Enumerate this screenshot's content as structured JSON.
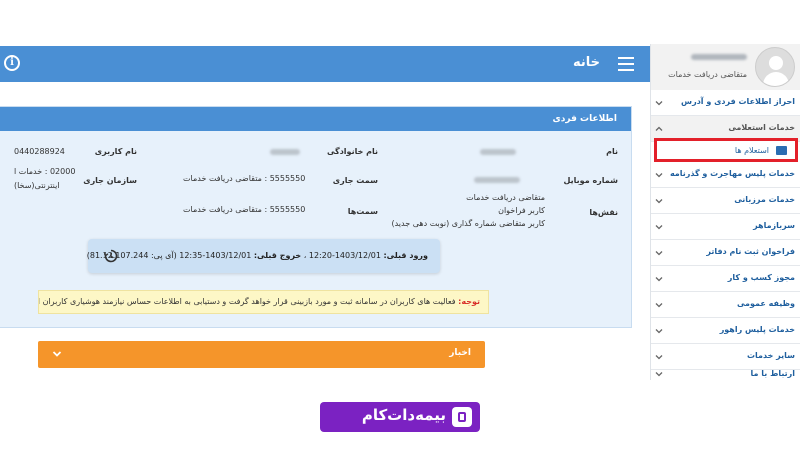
{
  "header": {
    "title": "خانه",
    "menu_icon": "hamburger-icon",
    "info_icon": "info-icon"
  },
  "profile": {
    "role": "متقاضی دریافت خدمات"
  },
  "sidebar": {
    "items": [
      {
        "label": "احراز اطلاعات فردی و آدرس"
      },
      {
        "label": "خدمات استعلامی",
        "expanded": true
      },
      {
        "label": "خدمات پلیس مهاجرت و گذرنامه"
      },
      {
        "label": "خدمات مرزبانی"
      },
      {
        "label": "سرباز‌ماهر"
      },
      {
        "label": "فراخوان ثبت نام دفاتر"
      },
      {
        "label": "مجوز کسب و کار"
      },
      {
        "label": "وظیفه عمومی"
      },
      {
        "label": "خدمات پلیس راهور"
      },
      {
        "label": "سایر خدمات"
      },
      {
        "label": "ارتباط با ما"
      }
    ],
    "sub_item": {
      "label": "استعلام ها",
      "icon": "search-list-icon"
    }
  },
  "panel": {
    "title": "اطلاعات فردی",
    "labels": {
      "name": "نام",
      "family": "نام خانوادگی",
      "username": "نام کاربری",
      "mobile": "شماره موبایل",
      "current_position": "سمت جاری",
      "current_org": "سازمان جاری",
      "roles": "نقش‌ها",
      "positions": "سمت‌ها"
    },
    "values": {
      "username": "0440288924",
      "current_position": "5555550 : متقاضی دریافت خدمات",
      "current_org_line1": "02000 : خدمات ا",
      "current_org_line2": "اینترنتی(سخا)",
      "roles": [
        "متقاضی دریافت خدمات",
        "کاربر فراخوان",
        "کاربر متقاضی شماره گذاری (نوبت دهی جدید)"
      ],
      "positions": "5555550 : متقاضی دریافت خدمات"
    }
  },
  "login_info": {
    "prev_login_label": "ورود قبلی:",
    "prev_login": "1403/12/01-12:20",
    "prev_logout_label": "خروج قبلی:",
    "prev_logout": "1403/12/01-12:35",
    "ip_label": "(آی پی:",
    "ip": "81.12.107.244)"
  },
  "notice": {
    "label": "توجه:",
    "text": "فعالیت های کاربران در سامانه ثبت و مورد بازبینی قرار خواهد گرفت و دستیابی به اطلاعات حساس نیازمند هوشیاری کاربران است."
  },
  "news": {
    "title": "اخبار"
  },
  "watermark": {
    "text": "بیمه‌دات‌کام"
  },
  "colors": {
    "primary": "#4a8fd4",
    "news": "#f5952a",
    "highlight_border": "#e3202a",
    "logo": "#7b22c2"
  }
}
